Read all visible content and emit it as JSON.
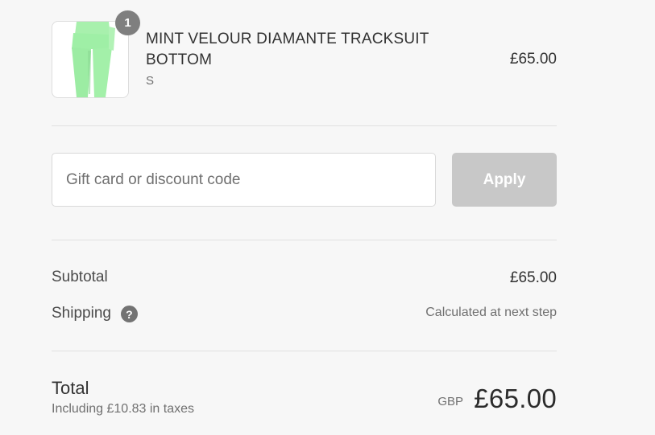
{
  "product": {
    "name": "MINT VELOUR DIAMANTE TRACKSUIT BOTTOM",
    "variant": "S",
    "price": "£65.00",
    "quantity": "1",
    "image_icon": "tracksuit-bottom-thumbnail"
  },
  "discount": {
    "placeholder": "Gift card or discount code",
    "value": "",
    "apply_label": "Apply"
  },
  "lines": {
    "subtotal_label": "Subtotal",
    "subtotal_value": "£65.00",
    "shipping_label": "Shipping",
    "shipping_help_icon": "question-circle-icon",
    "shipping_value": "Calculated at next step"
  },
  "total": {
    "label": "Total",
    "tax_note": "Including £10.83 in taxes",
    "currency": "GBP",
    "amount": "£65.00"
  },
  "colors": {
    "background": "#f7f7f7",
    "apply_disabled": "#c8c8c8",
    "badge": "#7f7f7f",
    "mint": "#9fefa6"
  }
}
